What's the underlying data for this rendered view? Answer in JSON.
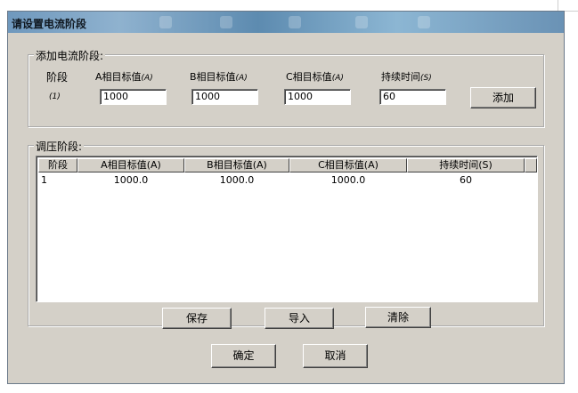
{
  "window": {
    "title": "请设置电流阶段"
  },
  "add_stage": {
    "legend": "添加电流阶段:",
    "labels": {
      "stage": "阶段",
      "a_target": "A相目标值",
      "b_target": "B相目标值",
      "c_target": "C相目标值",
      "duration": "持续时间",
      "unit_a": "(A)",
      "unit_s": "(S)"
    },
    "stage_index": "(1)",
    "inputs": {
      "a": "1000",
      "b": "1000",
      "c": "1000",
      "duration": "60"
    },
    "add_button": "添加"
  },
  "regulate": {
    "legend": "调压阶段:",
    "columns": [
      "阶段",
      "A相目标值(A)",
      "B相目标值(A)",
      "C相目标值(A)",
      "持续时间(S)"
    ],
    "rows": [
      {
        "stage": "1",
        "a": "1000.0",
        "b": "1000.0",
        "c": "1000.0",
        "duration": "60"
      }
    ],
    "buttons": {
      "save": "保存",
      "import": "导入",
      "clear": "清除"
    }
  },
  "footer": {
    "ok": "确定",
    "cancel": "取消"
  }
}
